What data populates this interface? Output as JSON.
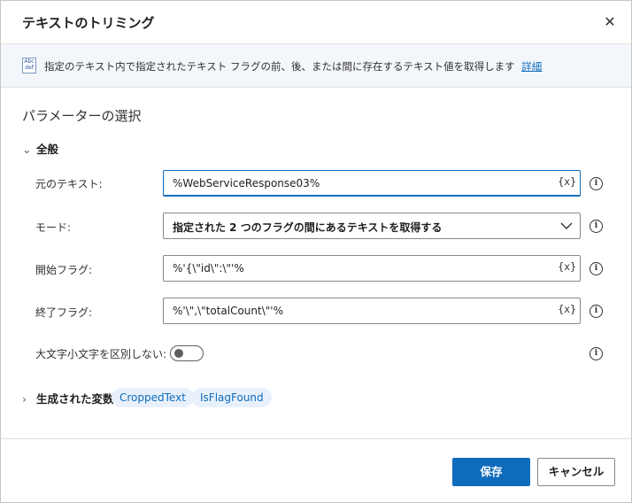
{
  "dialog": {
    "title": "テキストのトリミング",
    "close_glyph": "✕"
  },
  "infobar": {
    "icon_text_top": "Abc",
    "icon_text_bottom": "def",
    "text": "指定のテキスト内で指定されたテキスト フラグの前、後、または間に存在するテキスト値を取得します",
    "link": "詳細"
  },
  "section": {
    "title": "パラメーターの選択",
    "group_general": "全般"
  },
  "fields": {
    "original_text": {
      "label": "元のテキスト:",
      "value": "%WebServiceResponse03%",
      "var_button": "{x}"
    },
    "mode": {
      "label": "モード:",
      "value": "指定された 2 つのフラグの間にあるテキストを取得する"
    },
    "start_flag": {
      "label": "開始フラグ:",
      "value": "%'{\\\"id\\\":\\\"'%",
      "var_button": "{x}"
    },
    "end_flag": {
      "label": "終了フラグ:",
      "value": "%'\\\",\\\"totalCount\\\"'%",
      "var_button": "{x}"
    },
    "ignore_case": {
      "label": "大文字小文字を区別しない:",
      "checked": false
    }
  },
  "info_glyph": "i",
  "variables": {
    "header": "生成された変数",
    "chips": [
      "CroppedText",
      "IsFlagFound"
    ]
  },
  "footer": {
    "save": "保存",
    "cancel": "キャンセル"
  },
  "colors": {
    "accent": "#0f6cbd",
    "chip_bg": "#e8f1fb",
    "infobar_bg": "#f3f6fb"
  }
}
